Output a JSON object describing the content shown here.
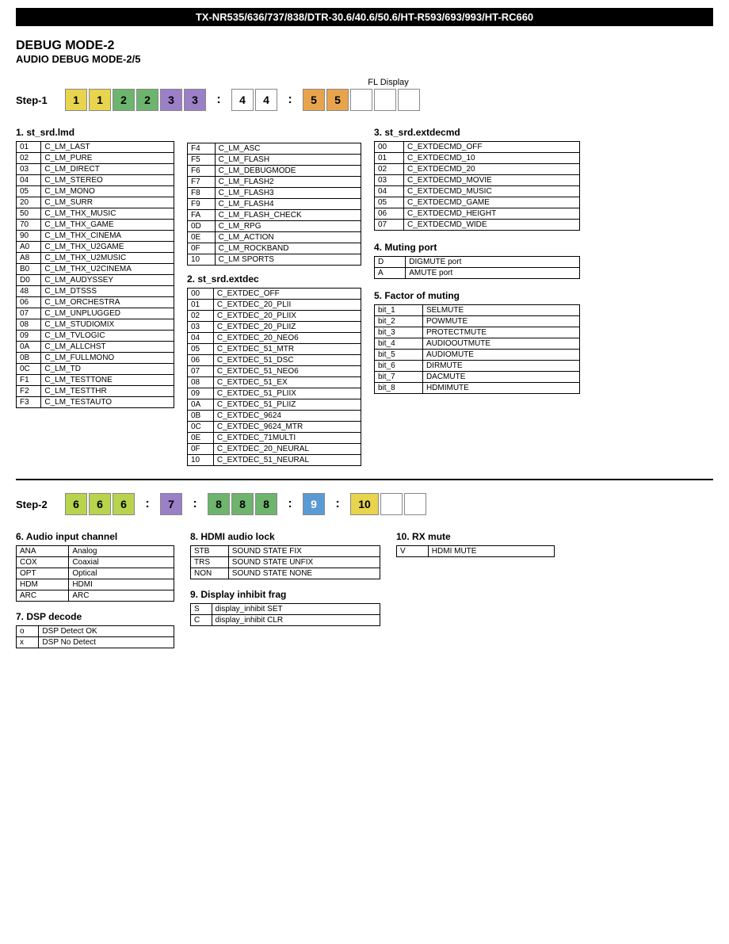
{
  "header": {
    "title": "TX-NR535/636/737/838/DTR-30.6/40.6/50.6/HT-R593/693/993/HT-RC660"
  },
  "page_title": "DEBUG MODE-2",
  "page_subtitle": "AUDIO DEBUG MODE-2/5",
  "fl_display_label": "FL Display",
  "step1": {
    "label": "Step-1",
    "cells": [
      {
        "value": "1",
        "color": "yellow"
      },
      {
        "value": "1",
        "color": "yellow"
      },
      {
        "value": "2",
        "color": "green"
      },
      {
        "value": "2",
        "color": "green"
      },
      {
        "value": "3",
        "color": "purple"
      },
      {
        "value": "3",
        "color": "purple"
      },
      {
        "value": ":",
        "color": "colon"
      },
      {
        "value": "4",
        "color": "white"
      },
      {
        "value": "4",
        "color": "white"
      },
      {
        "value": ":",
        "color": "colon"
      },
      {
        "value": "5",
        "color": "orange"
      },
      {
        "value": "5",
        "color": "orange"
      },
      {
        "value": "",
        "color": "white"
      },
      {
        "value": "",
        "color": "white"
      },
      {
        "value": "",
        "color": "white"
      }
    ]
  },
  "section1": {
    "title": "1. st_srd.lmd",
    "rows": [
      {
        "code": "01",
        "value": "C_LM_LAST"
      },
      {
        "code": "02",
        "value": "C_LM_PURE"
      },
      {
        "code": "03",
        "value": "C_LM_DIRECT"
      },
      {
        "code": "04",
        "value": "C_LM_STEREO"
      },
      {
        "code": "05",
        "value": "C_LM_MONO"
      },
      {
        "code": "20",
        "value": "C_LM_SURR"
      },
      {
        "code": "50",
        "value": "C_LM_THX_MUSIC"
      },
      {
        "code": "70",
        "value": "C_LM_THX_GAME"
      },
      {
        "code": "90",
        "value": "C_LM_THX_CINEMA"
      },
      {
        "code": "A0",
        "value": "C_LM_THX_U2GAME"
      },
      {
        "code": "A8",
        "value": "C_LM_THX_U2MUSIC"
      },
      {
        "code": "B0",
        "value": "C_LM_THX_U2CINEMA"
      },
      {
        "code": "D0",
        "value": "C_LM_AUDYSSEY"
      },
      {
        "code": "48",
        "value": "C_LM_DTSSS"
      },
      {
        "code": "06",
        "value": "C_LM_ORCHESTRA"
      },
      {
        "code": "07",
        "value": "C_LM_UNPLUGGED"
      },
      {
        "code": "08",
        "value": "C_LM_STUDIOMIX"
      },
      {
        "code": "09",
        "value": "C_LM_TVLOGIC"
      },
      {
        "code": "0A",
        "value": "C_LM_ALLCHST"
      },
      {
        "code": "0B",
        "value": "C_LM_FULLMONO"
      },
      {
        "code": "0C",
        "value": "C_LM_TD"
      },
      {
        "code": "F1",
        "value": "C_LM_TESTTONE"
      },
      {
        "code": "F2",
        "value": "C_LM_TESTTHR"
      },
      {
        "code": "F3",
        "value": "C_LM_TESTAUTO"
      }
    ]
  },
  "section1b": {
    "rows": [
      {
        "code": "F4",
        "value": "C_LM_ASC"
      },
      {
        "code": "F5",
        "value": "C_LM_FLASH"
      },
      {
        "code": "F6",
        "value": "C_LM_DEBUGMODE"
      },
      {
        "code": "F7",
        "value": "C_LM_FLASH2"
      },
      {
        "code": "F8",
        "value": "C_LM_FLASH3"
      },
      {
        "code": "F9",
        "value": "C_LM_FLASH4"
      },
      {
        "code": "FA",
        "value": "C_LM_FLASH_CHECK"
      },
      {
        "code": "0D",
        "value": "C_LM_RPG"
      },
      {
        "code": "0E",
        "value": "C_LM_ACTION"
      },
      {
        "code": "0F",
        "value": "C_LM_ROCKBAND"
      },
      {
        "code": "10",
        "value": "C_LM  SPORTS"
      }
    ]
  },
  "section2": {
    "title": "2. st_srd.extdec",
    "rows": [
      {
        "code": "00",
        "value": "C_EXTDEC_OFF"
      },
      {
        "code": "01",
        "value": "C_EXTDEC_20_PLII"
      },
      {
        "code": "02",
        "value": "C_EXTDEC_20_PLIIX"
      },
      {
        "code": "03",
        "value": "C_EXTDEC_20_PLIIZ"
      },
      {
        "code": "04",
        "value": "C_EXTDEC_20_NEO6"
      },
      {
        "code": "05",
        "value": "C_EXTDEC_51_MTR"
      },
      {
        "code": "06",
        "value": "C_EXTDEC_51_DSC"
      },
      {
        "code": "07",
        "value": "C_EXTDEC_51_NEO6"
      },
      {
        "code": "08",
        "value": "C_EXTDEC_51_EX"
      },
      {
        "code": "09",
        "value": "C_EXTDEC_51_PLIIX"
      },
      {
        "code": "0A",
        "value": "C_EXTDEC_51_PLIIZ"
      },
      {
        "code": "0B",
        "value": "C_EXTDEC_9624"
      },
      {
        "code": "0C",
        "value": "C_EXTDEC_9624_MTR"
      },
      {
        "code": "0E",
        "value": "C_EXTDEC_71MULTI"
      },
      {
        "code": "0F",
        "value": "C_EXTDEC_20_NEURAL"
      },
      {
        "code": "10",
        "value": "C_EXTDEC_51_NEURAL"
      }
    ]
  },
  "section3": {
    "title": "3. st_srd.extdecmd",
    "rows": [
      {
        "code": "00",
        "value": "C_EXTDECMD_OFF"
      },
      {
        "code": "01",
        "value": "C_EXTDECMD_10"
      },
      {
        "code": "02",
        "value": "C_EXTDECMD_20"
      },
      {
        "code": "03",
        "value": "C_EXTDECMD_MOVIE"
      },
      {
        "code": "04",
        "value": "C_EXTDECMD_MUSIC"
      },
      {
        "code": "05",
        "value": "C_EXTDECMD_GAME"
      },
      {
        "code": "06",
        "value": "C_EXTDECMD_HEIGHT"
      },
      {
        "code": "07",
        "value": "C_EXTDECMD_WIDE"
      }
    ]
  },
  "section4": {
    "title": "4. Muting port",
    "rows": [
      {
        "code": "D",
        "value": "DIGMUTE port"
      },
      {
        "code": "A",
        "value": "AMUTE port"
      }
    ]
  },
  "section5": {
    "title": "5. Factor of muting",
    "rows": [
      {
        "code": "bit_1",
        "value": "SELMUTE"
      },
      {
        "code": "bit_2",
        "value": "POWMUTE"
      },
      {
        "code": "bit_3",
        "value": "PROTECTMUTE"
      },
      {
        "code": "bit_4",
        "value": "AUDIOOUTMUTE"
      },
      {
        "code": "bit_5",
        "value": "AUDIOMUTE"
      },
      {
        "code": "bit_6",
        "value": "DIRMUTE"
      },
      {
        "code": "bit_7",
        "value": "DACMUTE"
      },
      {
        "code": "bit_8",
        "value": "HDMIMUTE"
      }
    ]
  },
  "step2": {
    "label": "Step-2",
    "cells": [
      {
        "value": "6",
        "color": "lime"
      },
      {
        "value": "6",
        "color": "lime"
      },
      {
        "value": "6",
        "color": "lime"
      },
      {
        "value": ":",
        "color": "colon"
      },
      {
        "value": "7",
        "color": "purple"
      },
      {
        "value": ":",
        "color": "colon"
      },
      {
        "value": "8",
        "color": "green"
      },
      {
        "value": "8",
        "color": "green"
      },
      {
        "value": "8",
        "color": "green"
      },
      {
        "value": ":",
        "color": "colon"
      },
      {
        "value": "9",
        "color": "blue"
      },
      {
        "value": ":",
        "color": "colon"
      },
      {
        "value": "10",
        "color": "yellow"
      },
      {
        "value": "",
        "color": "white"
      },
      {
        "value": "",
        "color": "white"
      }
    ]
  },
  "section6": {
    "title": "6. Audio input channel",
    "rows": [
      {
        "code": "ANA",
        "value": "Analog"
      },
      {
        "code": "COX",
        "value": "Coaxial"
      },
      {
        "code": "OPT",
        "value": "Optical"
      },
      {
        "code": "HDM",
        "value": "HDMI"
      },
      {
        "code": "ARC",
        "value": "ARC"
      }
    ]
  },
  "section7": {
    "title": "7. DSP decode",
    "rows": [
      {
        "code": "o",
        "value": "DSP Detect OK"
      },
      {
        "code": "x",
        "value": "DSP No Detect"
      }
    ]
  },
  "section8": {
    "title": "8. HDMI audio lock",
    "rows": [
      {
        "code": "STB",
        "value": "SOUND STATE FIX"
      },
      {
        "code": "TRS",
        "value": "SOUND STATE UNFIX"
      },
      {
        "code": "NON",
        "value": "SOUND STATE NONE"
      }
    ]
  },
  "section9": {
    "title": "9. Display inhibit frag",
    "rows": [
      {
        "code": "S",
        "value": "display_inhibit SET"
      },
      {
        "code": "C",
        "value": "display_inhibit CLR"
      }
    ]
  },
  "section10": {
    "title": "10. RX mute",
    "rows": [
      {
        "code": "V",
        "value": "HDMI MUTE"
      }
    ]
  }
}
